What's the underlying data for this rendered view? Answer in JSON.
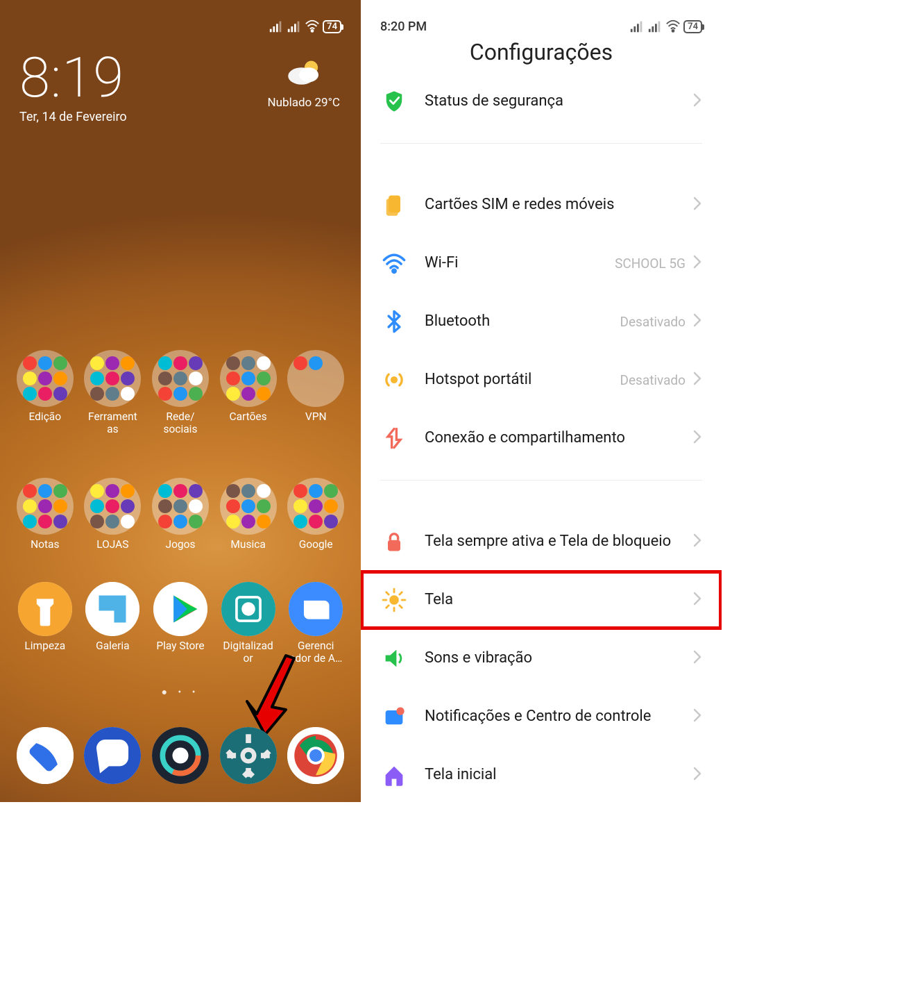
{
  "homescreen": {
    "status": {
      "battery": "74"
    },
    "clock": {
      "time": "8:19",
      "date": "Ter, 14 de Fevereiro"
    },
    "weather": {
      "text": "Nublado  29°C"
    },
    "folders_row1": [
      {
        "label": "Edição"
      },
      {
        "label": "Ferrament\nas"
      },
      {
        "label": "Rede/\nsociais"
      },
      {
        "label": "Cartões"
      },
      {
        "label": "VPN"
      }
    ],
    "folders_row2": [
      {
        "label": "Notas"
      },
      {
        "label": "LOJAS"
      },
      {
        "label": "Jogos"
      },
      {
        "label": "Musica"
      },
      {
        "label": "Google"
      }
    ],
    "apps_row": [
      {
        "label": "Limpeza"
      },
      {
        "label": "Galeria"
      },
      {
        "label": "Play Store"
      },
      {
        "label": "Digitalizad\nor"
      },
      {
        "label": "Gerenci\nador de A…"
      }
    ],
    "dock": [
      {
        "name": "phone"
      },
      {
        "name": "messages"
      },
      {
        "name": "browser"
      },
      {
        "name": "settings"
      },
      {
        "name": "chrome"
      }
    ]
  },
  "settings": {
    "status": {
      "time": "8:20 PM",
      "battery": "74"
    },
    "title": "Configurações",
    "items": [
      {
        "icon": "shield",
        "iconColor": "#27c24c",
        "label": "Status de segurança",
        "value": ""
      },
      {
        "divider": true
      },
      {
        "icon": "sim",
        "iconColor": "#f7b731",
        "label": "Cartões SIM e redes móveis",
        "value": ""
      },
      {
        "icon": "wifi",
        "iconColor": "#2f8cff",
        "label": "Wi-Fi",
        "value": "SCHOOL 5G"
      },
      {
        "icon": "bluetooth",
        "iconColor": "#2f8cff",
        "label": "Bluetooth",
        "value": "Desativado"
      },
      {
        "icon": "hotspot",
        "iconColor": "#f7b731",
        "label": "Hotspot portátil",
        "value": "Desativado"
      },
      {
        "icon": "share",
        "iconColor": "#f26a5a",
        "label": "Conexão e compartilhamento",
        "value": ""
      },
      {
        "divider": true
      },
      {
        "icon": "lock",
        "iconColor": "#f26a5a",
        "label": "Tela sempre ativa e Tela de bloqueio",
        "value": ""
      },
      {
        "icon": "sun",
        "iconColor": "#f7b731",
        "label": "Tela",
        "value": "",
        "highlight": true
      },
      {
        "icon": "sound",
        "iconColor": "#27c24c",
        "label": "Sons e vibração",
        "value": ""
      },
      {
        "icon": "notif",
        "iconColor": "#2f8cff",
        "label": "Notificações e Centro de controle",
        "value": ""
      },
      {
        "icon": "home",
        "iconColor": "#8b5cf6",
        "label": "Tela inicial",
        "value": ""
      }
    ]
  }
}
